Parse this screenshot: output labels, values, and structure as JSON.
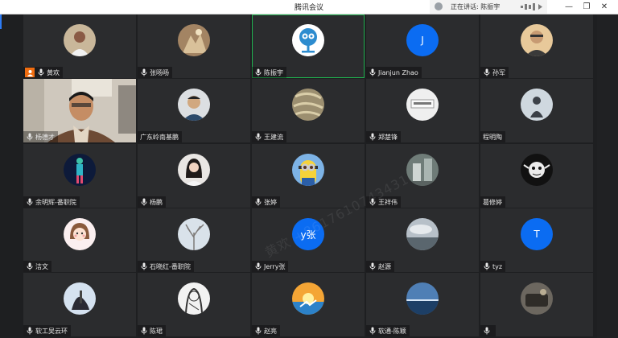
{
  "window": {
    "title": "腾讯会议",
    "speaking_label": "正在讲话: 陈振宇"
  },
  "watermark": "黄欢 +8617610743431",
  "participants": [
    {
      "name": "黄欢",
      "host": true,
      "avatar": "photo-1"
    },
    {
      "name": "张旸旸",
      "avatar": "photo-2"
    },
    {
      "name": "陈振宇",
      "active": true,
      "avatar": "logo-blue"
    },
    {
      "name": "Jianjun Zhao",
      "letter": "J"
    },
    {
      "name": "孙军",
      "avatar": "photo-man"
    },
    {
      "name": "杨德才",
      "video": true
    },
    {
      "name": "广东岭南基鹏",
      "noMic": true,
      "avatar": "photo-man2"
    },
    {
      "name": "王建流",
      "avatar": "photo-bark"
    },
    {
      "name": "郑楚锋",
      "avatar": "photo-sign"
    },
    {
      "name": "程明陶",
      "noMic": true,
      "avatar": "photo-silhouette"
    },
    {
      "name": "余明辉-番职院",
      "avatar": "photo-figure"
    },
    {
      "name": "杨鹏",
      "avatar": "photo-woman"
    },
    {
      "name": "张婷",
      "avatar": "minion"
    },
    {
      "name": "王祥伟",
      "avatar": "photo-building"
    },
    {
      "name": "葛修婷",
      "noMic": true,
      "avatar": "photo-cartoon"
    },
    {
      "name": "洁文",
      "avatar": "cartoon-girl"
    },
    {
      "name": "石晓红-番职院",
      "avatar": "photo-tree"
    },
    {
      "name": "Jerry张",
      "letter": "y张"
    },
    {
      "name": "赵源",
      "avatar": "photo-cloud"
    },
    {
      "name": "tyz",
      "letter": "T"
    },
    {
      "name": "软工吴云环",
      "avatar": "photo-sky"
    },
    {
      "name": "陈珺",
      "avatar": "photo-sketch"
    },
    {
      "name": "赵亮",
      "avatar": "photo-sunset"
    },
    {
      "name": "软通-陈颖",
      "avatar": "photo-ocean"
    },
    {
      "name": "",
      "avatar": "photo-dark"
    }
  ]
}
